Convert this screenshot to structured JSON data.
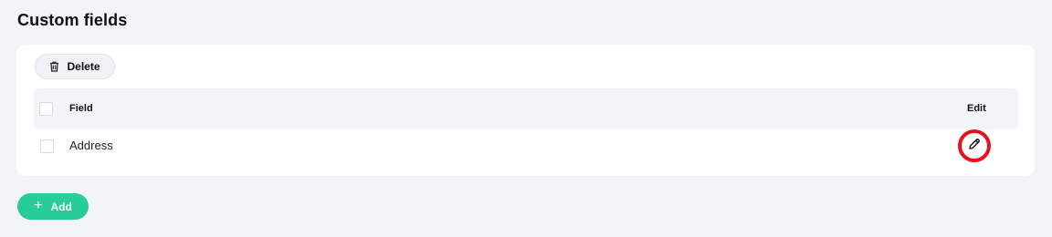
{
  "page": {
    "title": "Custom fields"
  },
  "toolbar": {
    "delete_label": "Delete",
    "delete_icon": "trash-icon"
  },
  "table": {
    "columns": [
      "Field",
      "Edit"
    ],
    "rows": [
      {
        "label": "Address",
        "checked": false,
        "edit_icon": "pencil-icon"
      }
    ]
  },
  "actions": {
    "add_label": "Add",
    "add_icon": "plus-icon"
  },
  "colors": {
    "background": "#f3f4f8",
    "card": "#ffffff",
    "accent_green": "#27cc98",
    "highlight_red": "#e8101a"
  }
}
